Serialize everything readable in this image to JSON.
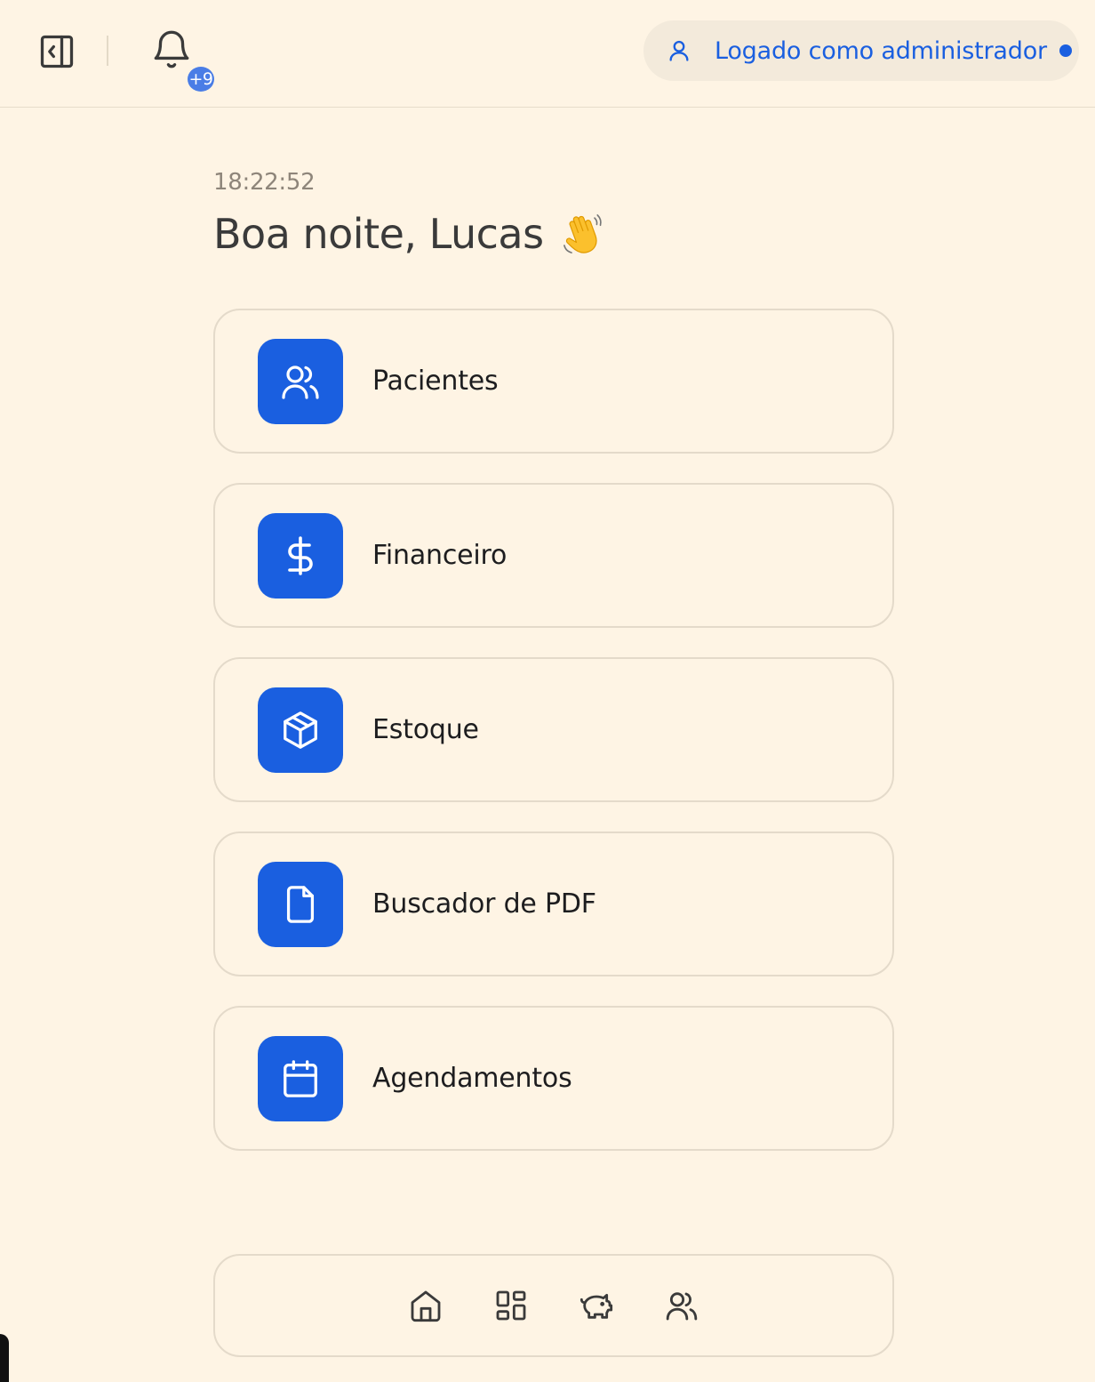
{
  "header": {
    "notification_badge": "+9",
    "user_status_label": "Logado como administrador",
    "accent_color": "#1A5FE0"
  },
  "main": {
    "clock": "18:22:52",
    "greeting": "Boa noite, Lucas",
    "greeting_emoji": "waving-hand"
  },
  "cards": [
    {
      "label": "Pacientes",
      "icon": "users-icon"
    },
    {
      "label": "Financeiro",
      "icon": "dollar-icon"
    },
    {
      "label": "Estoque",
      "icon": "box-icon"
    },
    {
      "label": "Buscador de PDF",
      "icon": "file-icon"
    },
    {
      "label": "Agendamentos",
      "icon": "calendar-icon"
    }
  ],
  "bottom_nav": [
    {
      "icon": "home-icon"
    },
    {
      "icon": "grid-icon"
    },
    {
      "icon": "piggy-bank-icon"
    },
    {
      "icon": "users-icon"
    }
  ]
}
